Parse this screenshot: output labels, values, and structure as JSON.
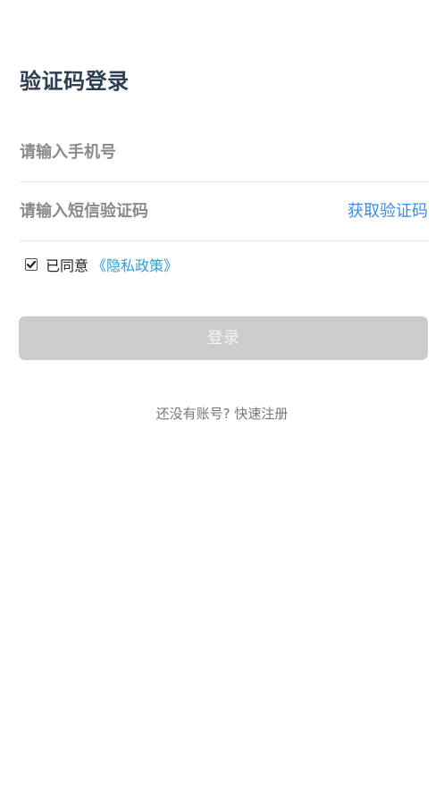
{
  "page": {
    "title": "验证码登录"
  },
  "form": {
    "phone_placeholder": "请输入手机号",
    "phone_value": "",
    "code_placeholder": "请输入短信验证码",
    "code_value": "",
    "get_code_label": "获取验证码"
  },
  "agreement": {
    "checked": true,
    "text": "已同意",
    "policy_link": "《隐私政策》"
  },
  "actions": {
    "login_label": "登录"
  },
  "register": {
    "prompt": "还没有账号?",
    "link": "快速注册"
  },
  "colors": {
    "title": "#2e3e52",
    "link_blue": "#3a8ee6",
    "policy_blue": "#2a9fd8",
    "button_disabled": "#cccccc"
  },
  "icons": {
    "checkbox": "check-icon"
  }
}
